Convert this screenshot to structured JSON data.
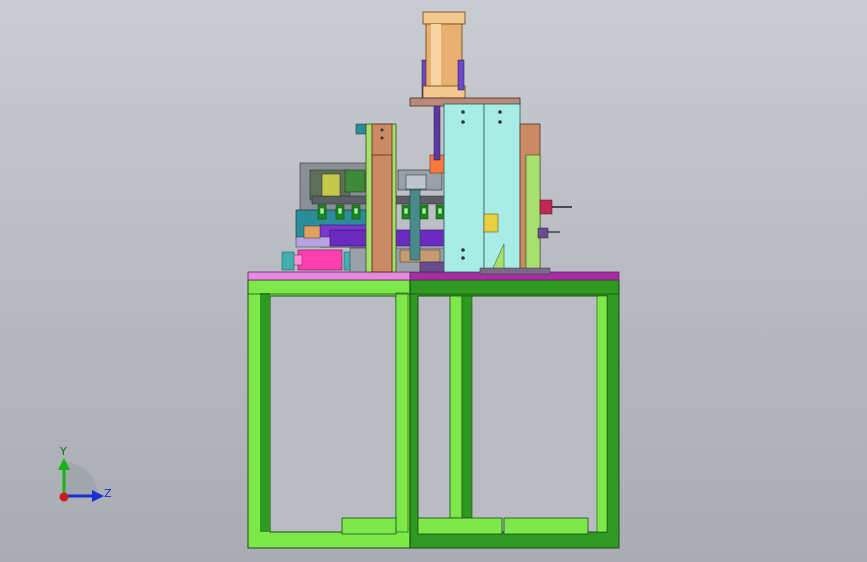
{
  "viewport": {
    "background_top": "#c9ccd1",
    "background_bottom": "#a9adb3"
  },
  "triad": {
    "y_label": "Y",
    "z_label": "Z",
    "y_color": "#15b515",
    "z_color": "#1a2fd6",
    "x_color": "#d01818"
  },
  "colors": {
    "frame_light": "#7de84a",
    "frame_dark": "#2f9a22",
    "frame_outline": "#1c4a12",
    "top_plate": "#c64fc2",
    "cylinder": "#e8b070",
    "plate_cyan": "#a8ece6",
    "column_brown": "#c98a64",
    "column_green": "#a8e070",
    "mechanism_purple": "#7a38d0",
    "mechanism_magenta": "#ff3fb0",
    "mechanism_grey": "#9aa0a8"
  }
}
